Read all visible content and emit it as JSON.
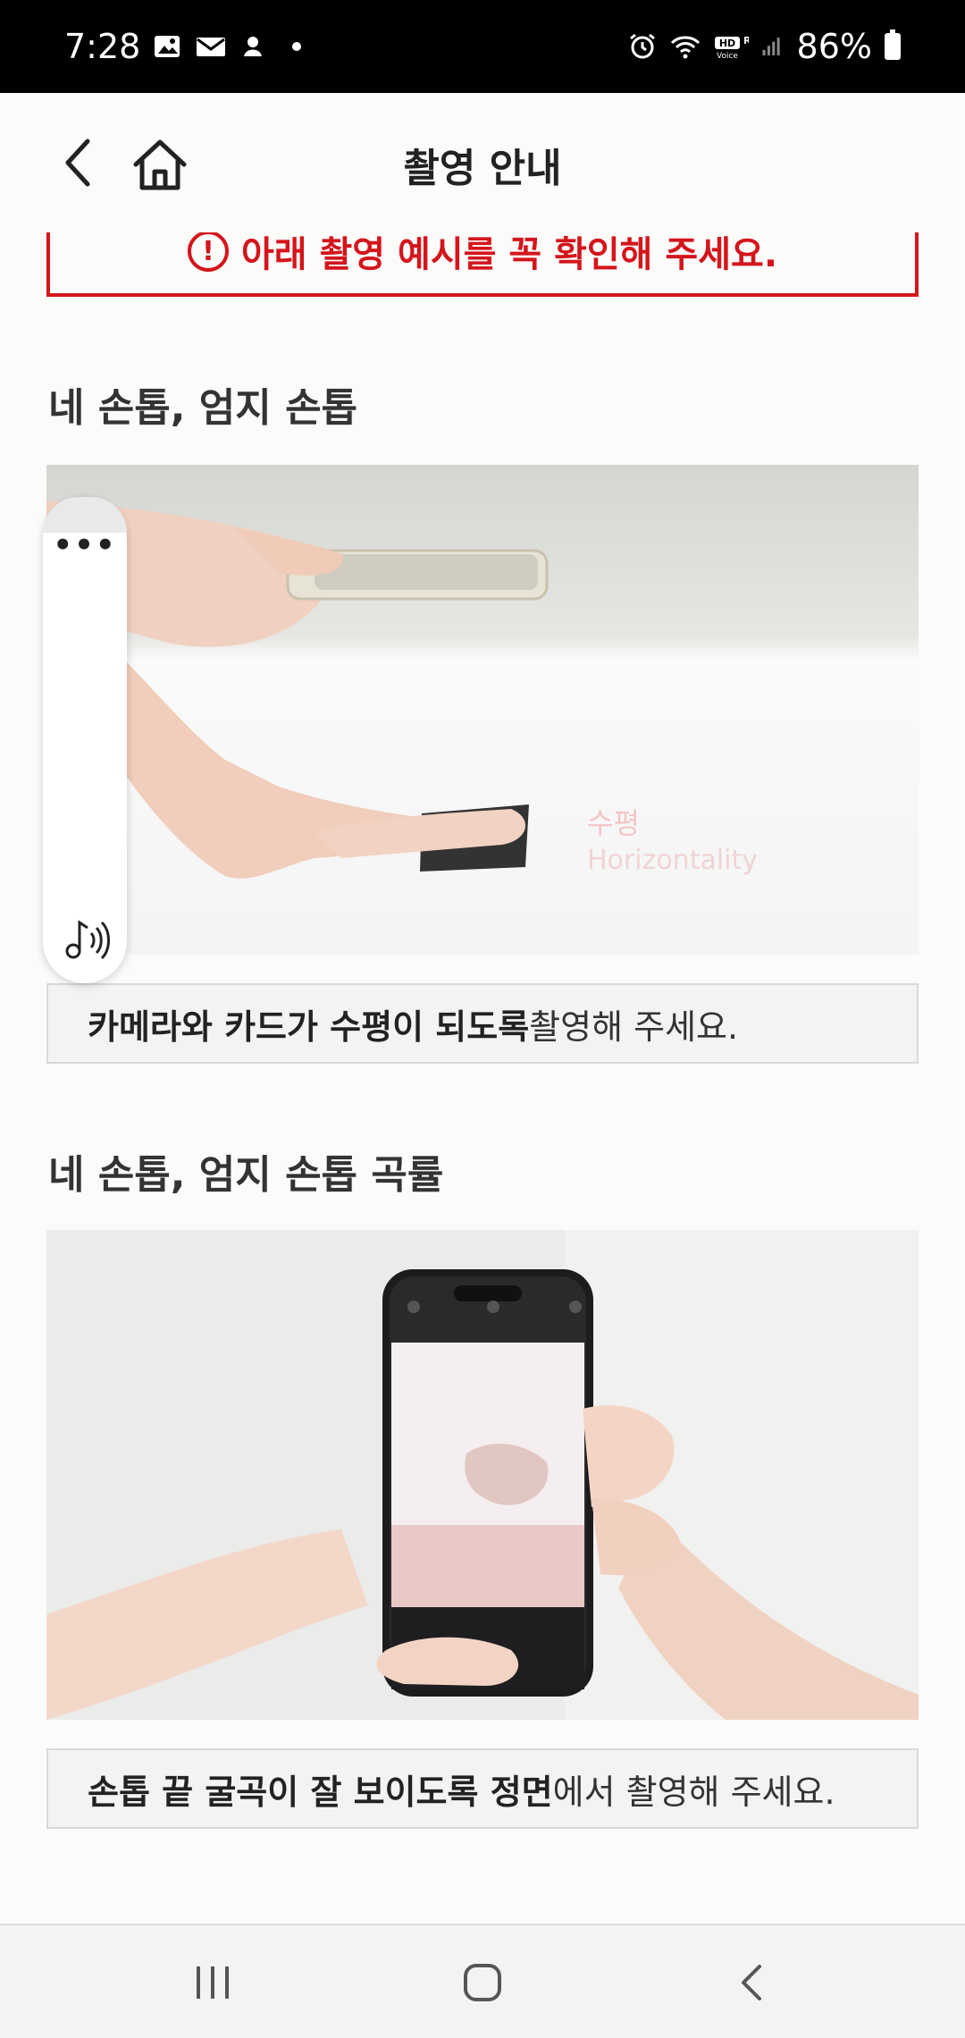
{
  "status_bar": {
    "time": "7:28",
    "battery": "86%",
    "icons": [
      "gallery-icon",
      "mail-icon",
      "app-notification-icon",
      "alarm-icon",
      "wifi-icon",
      "hd-voice-icon",
      "signal-icon",
      "battery-icon"
    ]
  },
  "header": {
    "title": "촬영 안내"
  },
  "notice": {
    "text": "아래 촬영 예시를 꼭 확인해 주세요."
  },
  "sections": [
    {
      "title": "네 손톱, 엄지 손톱",
      "photo_overlay": {
        "ko": "수평",
        "en": "Horizontality"
      },
      "caption_bold": "카메라와 카드가 수평이 되도록",
      "caption_rest": " 촬영해 주세요."
    },
    {
      "title": "네 손톱, 엄지 손톱 곡률",
      "caption_bold_1": "손톱 끝 굴곡이 잘 보이도록 정면",
      "caption_rest": "에서 촬영해 주세요."
    }
  ],
  "float_panel": {
    "more": "•••"
  },
  "colors": {
    "accent_red": "#d4151c",
    "background": "#fbfbfa"
  }
}
